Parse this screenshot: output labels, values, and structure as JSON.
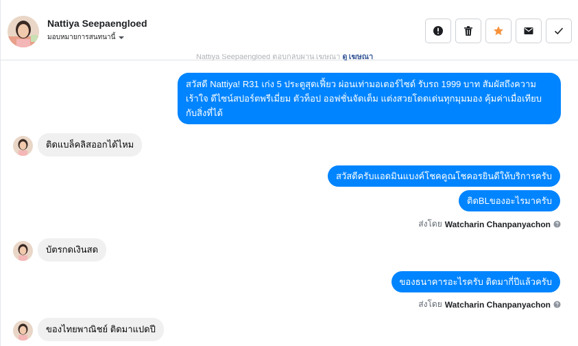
{
  "header": {
    "name": "Nattiya Seepaengloed",
    "subtitle": "มอบหมายการสนทนานี้",
    "actions": [
      {
        "icon": "alert-icon",
        "label": "report"
      },
      {
        "icon": "trash-icon",
        "label": "delete"
      },
      {
        "icon": "star-icon",
        "label": "star"
      },
      {
        "icon": "envelope-icon",
        "label": "mark-unread"
      },
      {
        "icon": "check-icon",
        "label": "done"
      }
    ]
  },
  "faded_line": {
    "text": "Nattiya Seepaengloed ตอบกลับผ่านโฆษณา ",
    "link": "ดูโฆษณา"
  },
  "messages": {
    "m1": "สวัสดี Nattiya! R31 เก่ง 5 ประตูสุดเฟี้ยว ผ่อนเท่ามอเตอร์ไซด์ รับรถ 1999 บาท สัมผัสถึงความเร้าใจ ดีไซน์สปอร์ตพรีเมี่ยม ตัวท็อป ออฟชั่นจัดเต็ม แต่งสวยโดดเด่นทุกมุมมอง คุ้มค่าเมื่อเทียบกับสิ่งที่ได้",
    "m2": "ติดแบล็คลิสออกได้ไหม",
    "m3": "สวัสดีครับแอดมินแบงค์โชคคูณโชคอรยินดีให้บริการครับ",
    "m4": "ติดBLของอะไรมาครับ",
    "m5": "บัตรกดเงินสด",
    "m6": "ของธนาคารอะไรครับ ติดมากี่ปีแล้วครับ",
    "m7": "ของไทยพาณิชย์ ติดมาแปดปี"
  },
  "sent_by": {
    "prefix": "ส่งโดย",
    "sender": "Watcharin Chanpanyachon"
  },
  "colors": {
    "outgoing_bubble": "#0084ff",
    "incoming_bubble": "#f0f0f0",
    "star": "#f7923b"
  }
}
